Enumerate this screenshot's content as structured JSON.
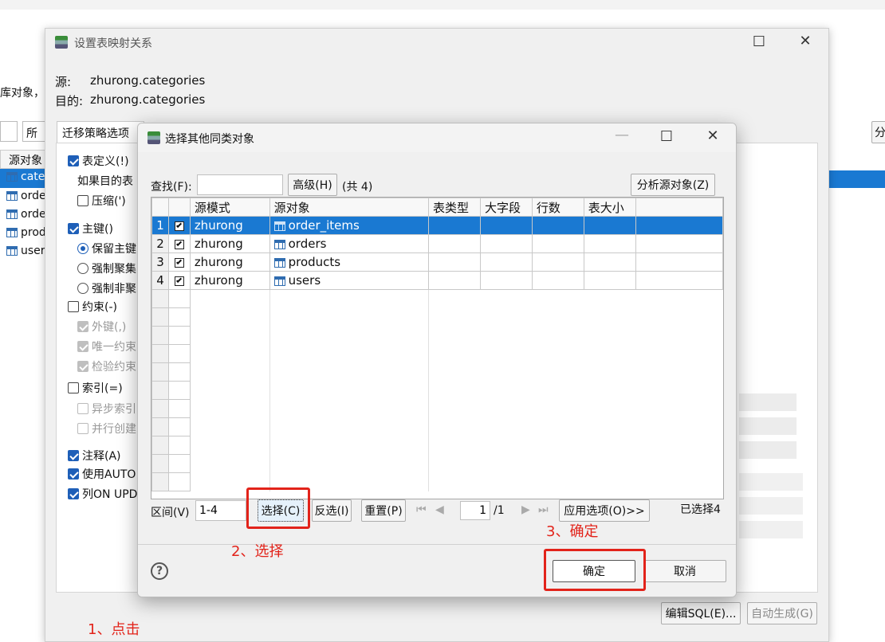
{
  "background": {
    "left_label": "库对象，",
    "filter_value": "所有",
    "column_header": "源对象",
    "objects": [
      "cate",
      "orde",
      "orde",
      "prod",
      "user"
    ],
    "right_button": "分",
    "edit_sql_button": "编辑SQL(E)...",
    "auto_generate_button": "自动生成(G)"
  },
  "outer_dialog": {
    "title": "设置表映射关系",
    "source_label": "源:",
    "source_value": "zhurong.categories",
    "target_label": "目的:",
    "target_value": "zhurong.categories",
    "tab_label": "迁移策略选项",
    "options": [
      {
        "label": "表定义(!)",
        "type": "checkbox",
        "state": "checked"
      },
      {
        "label": "如果目的表",
        "type": "text"
      },
      {
        "label": "压缩(')",
        "type": "checkbox",
        "state": "unchecked"
      },
      {
        "label": "主键()",
        "type": "checkbox",
        "state": "checked"
      },
      {
        "label": "保留主键",
        "type": "radio",
        "state": "selected"
      },
      {
        "label": "强制聚集",
        "type": "radio",
        "state": "unselected"
      },
      {
        "label": "强制非聚",
        "type": "radio",
        "state": "unselected"
      },
      {
        "label": "约束(-)",
        "type": "checkbox",
        "state": "unchecked"
      },
      {
        "label": "外键(,)",
        "type": "checkbox",
        "state": "disabled-checked"
      },
      {
        "label": "唯一约束",
        "type": "checkbox",
        "state": "disabled-checked"
      },
      {
        "label": "检验约束",
        "type": "checkbox",
        "state": "disabled-checked"
      },
      {
        "label": "索引(=)",
        "type": "checkbox",
        "state": "unchecked"
      },
      {
        "label": "异步索引",
        "type": "checkbox",
        "state": "disabled-unchecked"
      },
      {
        "label": "并行创建",
        "type": "checkbox",
        "state": "disabled-unchecked"
      },
      {
        "label": "注释(A)",
        "type": "checkbox",
        "state": "checked"
      },
      {
        "label": "使用AUTO",
        "type": "checkbox",
        "state": "checked"
      },
      {
        "label": "列ON UPD",
        "type": "checkbox",
        "state": "checked"
      }
    ]
  },
  "dialog": {
    "title": "选择其他同类对象",
    "search_label": "查找(F):",
    "search_value": "",
    "advanced_button": "高级(H)",
    "count_text": "(共 4)",
    "analyze_button": "分析源对象(Z)",
    "columns": [
      "源模式",
      "源对象",
      "表类型",
      "大字段",
      "行数",
      "表大小"
    ],
    "rows": [
      {
        "num": "1",
        "schema": "zhurong",
        "object": "order_items",
        "checked": true,
        "selected": true
      },
      {
        "num": "2",
        "schema": "zhurong",
        "object": "orders",
        "checked": true,
        "selected": false
      },
      {
        "num": "3",
        "schema": "zhurong",
        "object": "products",
        "checked": true,
        "selected": false
      },
      {
        "num": "4",
        "schema": "zhurong",
        "object": "users",
        "checked": true,
        "selected": false
      }
    ],
    "range_label": "区间(V)",
    "range_value": "1-4",
    "select_button": "选择(C)",
    "invert_button": "反选(I)",
    "reset_button": "重置(P)",
    "page_value": "1",
    "page_total": "/1",
    "apply_button": "应用选项(O)>>",
    "selected_count": "已选择4",
    "ok_button": "确定",
    "cancel_button": "取消"
  },
  "annotations": {
    "step1": "1、点击",
    "step2": "2、选择",
    "step3": "3、确定"
  },
  "colors": {
    "accent": "#1a79d2",
    "annotation": "#e2231a"
  }
}
